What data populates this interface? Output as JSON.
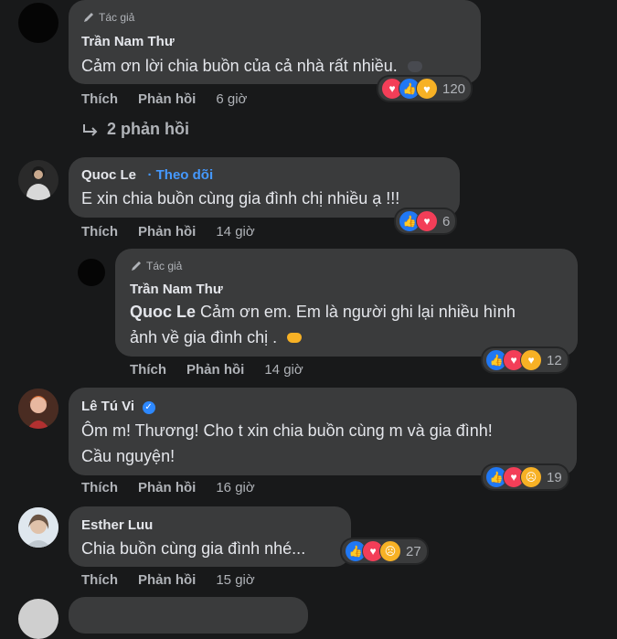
{
  "labels": {
    "like": "Thích",
    "reply": "Phản hồi",
    "author": "Tác giả"
  },
  "comments": [
    {
      "name": "Trần Nam Thư",
      "text": "Cảm ơn lời chia buồn của cả nhà rất nhiều.",
      "time": "6 giờ",
      "reactions": "120",
      "reactions_icons": [
        "love-icon",
        "like-icon",
        "care-icon"
      ]
    },
    {
      "replies_label": "2 phản hồi"
    },
    {
      "name": "Quoc Le",
      "follow": "Theo dõi",
      "text": "E xin chia buồn cùng gia đình chị nhiều ạ !!!",
      "time": "14 giờ",
      "reactions": "6"
    },
    {
      "name": "Trần Nam Thư",
      "mention": "Quoc Le",
      "text_line1": "Cảm ơn em. Em là người ghi lại nhiều hình",
      "text_line2": "ảnh về gia đình chị .",
      "time": "14 giờ",
      "reactions": "12"
    },
    {
      "name": "Lê Tú Vi",
      "text_line1": "Ôm m! Thương! Cho t xin chia buồn cùng m và gia đình!",
      "text_line2": "Cầu nguyện!",
      "time": "16 giờ",
      "reactions": "19"
    },
    {
      "name": "Esther Luu",
      "text": "Chia buồn cùng gia đình nhé...",
      "time": "15 giờ",
      "reactions": "27"
    }
  ],
  "colors": {
    "background": "#18191a",
    "bubble": "#3a3b3c",
    "link": "#4599ff"
  }
}
